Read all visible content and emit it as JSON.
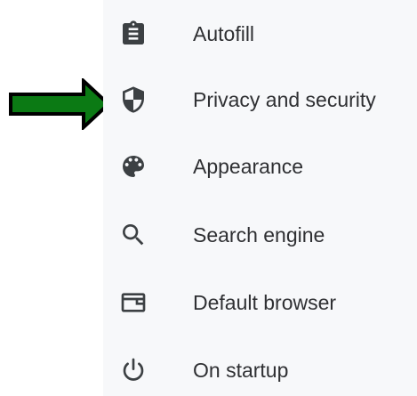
{
  "sidebar": {
    "items": [
      {
        "label": "Autofill",
        "icon": "clipboard-icon"
      },
      {
        "label": "Privacy and security",
        "icon": "shield-icon"
      },
      {
        "label": "Appearance",
        "icon": "palette-icon"
      },
      {
        "label": "Search engine",
        "icon": "search-icon"
      },
      {
        "label": "Default browser",
        "icon": "browser-window-icon"
      },
      {
        "label": "On startup",
        "icon": "power-icon"
      }
    ]
  },
  "annotation": {
    "arrow_icon": "right-arrow-icon",
    "arrow_color": "#0b7a14",
    "arrow_outline": "#000000",
    "points_to": "Privacy and security"
  },
  "colors": {
    "sidebar_background": "#f7f8fa",
    "text": "#2f3033",
    "icon": "#3c4043"
  }
}
